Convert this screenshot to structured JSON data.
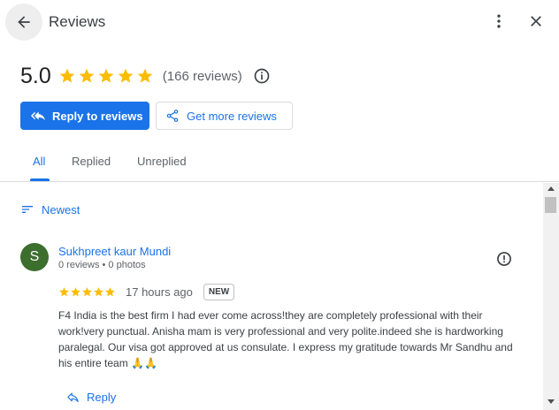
{
  "header": {
    "title": "Reviews",
    "back_icon": "arrow-back-icon",
    "more_icon": "more-vert-icon",
    "close_icon": "close-icon"
  },
  "summary": {
    "rating": "5.0",
    "stars": 5,
    "review_count": "(166 reviews)",
    "info_icon": "info-icon"
  },
  "actions": {
    "reply_label": "Reply to reviews",
    "more_reviews_label": "Get more reviews"
  },
  "tabs": [
    {
      "label": "All",
      "active": true
    },
    {
      "label": "Replied",
      "active": false
    },
    {
      "label": "Unreplied",
      "active": false
    }
  ],
  "sort": {
    "label": "Newest",
    "icon": "sort-icon"
  },
  "review": {
    "avatar_letter": "S",
    "name": "Sukhpreet kaur Mundi",
    "meta": "0 reviews • 0 photos",
    "stars": 5,
    "time": "17 hours ago",
    "badge": "NEW",
    "text": "F4 India is the best firm I had ever come across!they are completely professional with their work!very punctual. Anisha mam is very professional and very polite.indeed she is hardworking paralegal. Our visa got approved at us consulate. I express my gratitude towards Mr Sandhu and his entire team 🙏🙏",
    "reply_label": "Reply"
  },
  "colors": {
    "accent": "#1a73e8",
    "star": "#fbbc04",
    "avatar": "#3c6e2e"
  }
}
